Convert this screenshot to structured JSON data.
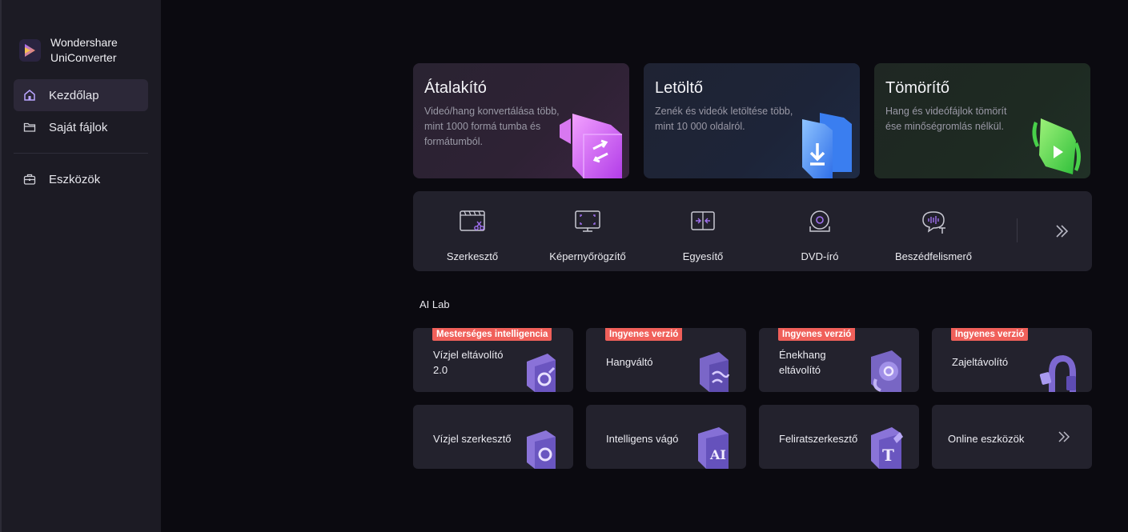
{
  "app": {
    "name": "Wondershare UniConverter"
  },
  "sidebar": {
    "items": [
      {
        "label": "Kezdőlap",
        "icon": "home-icon",
        "active": true
      },
      {
        "label": "Saját fájlok",
        "icon": "folder-icon",
        "active": false
      },
      {
        "label": "Eszközök",
        "icon": "toolbox-icon",
        "active": false
      }
    ]
  },
  "features": [
    {
      "title": "Átalakító",
      "description": "Videó/hang konvertálása több, mint 1000 formá tumba és formátumból."
    },
    {
      "title": "Letöltő",
      "description": "Zenék és videók letöltése több, mint 10 000 oldalról."
    },
    {
      "title": "Tömörítő",
      "description": "Hang és videófájlok tömörít ése minőségromlás nélkül."
    }
  ],
  "tools": [
    {
      "label": "Szerkesztő",
      "icon": "video-editor-icon"
    },
    {
      "label": "Képernyőrögzítő",
      "icon": "screen-recorder-icon"
    },
    {
      "label": "Egyesítő",
      "icon": "merger-icon"
    },
    {
      "label": "DVD-író",
      "icon": "dvd-burner-icon"
    },
    {
      "label": "Beszédfelismerő",
      "icon": "speech-to-text-icon"
    }
  ],
  "ai_lab": {
    "heading": "AI Lab",
    "cards": [
      {
        "label": "Vízjel eltávolító 2.0",
        "badge": "Mesterséges intelligencia",
        "icon": "watermark-remover-icon"
      },
      {
        "label": "Hangváltó",
        "badge": "Ingyenes verzió",
        "icon": "voice-changer-icon"
      },
      {
        "label": "Énekhang eltávolító",
        "badge": "Ingyenes verzió",
        "icon": "vocal-remover-icon"
      },
      {
        "label": "Zajeltávolító",
        "badge": "Ingyenes verzió",
        "icon": "noise-remover-icon"
      },
      {
        "label": "Vízjel szerkesztő",
        "badge": "",
        "icon": "watermark-editor-icon"
      },
      {
        "label": "Intelligens vágó",
        "badge": "",
        "icon": "ai-trimmer-icon"
      },
      {
        "label": "Feliratszerkesztő",
        "badge": "",
        "icon": "subtitle-editor-icon"
      },
      {
        "label": "Online eszközök",
        "badge": "",
        "icon": "chevron-double-right-icon"
      }
    ]
  },
  "colors": {
    "background": "#0b0a10",
    "sidebar": "#1c1b24",
    "card": "#23222d",
    "badge": "#f0605a",
    "accent_purple": "#a070f0"
  }
}
